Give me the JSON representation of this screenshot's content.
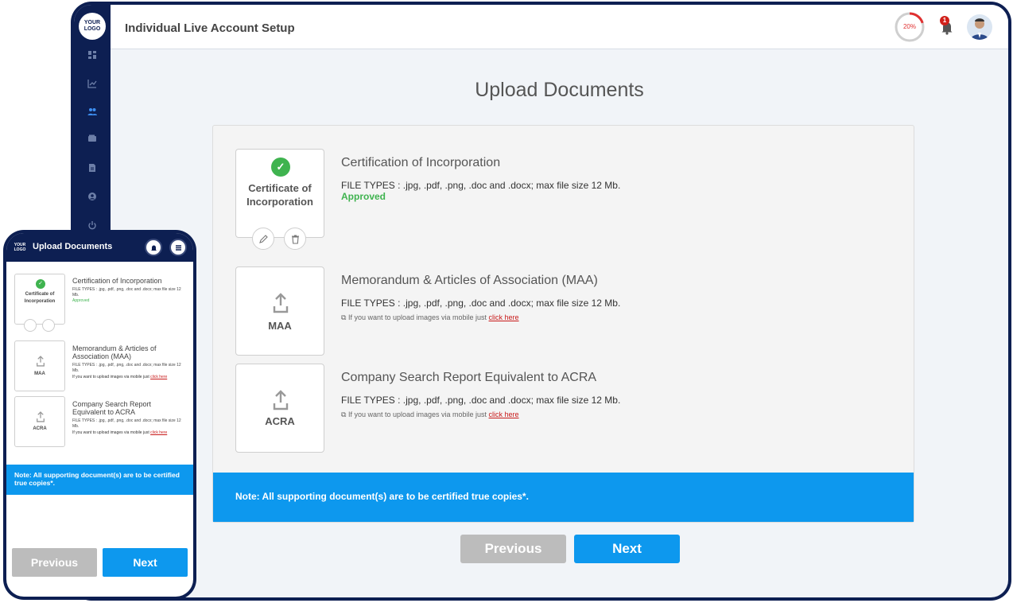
{
  "desktop": {
    "logo_text": "YOUR LOGO",
    "header_title": "Individual Live Account Setup",
    "progress_label": "20%",
    "progress_value": 0.2,
    "notification_count": "1",
    "page_title": "Upload Documents",
    "documents": [
      {
        "card_label": "Certificate of Incorporation",
        "name": "Certification of Incorporation",
        "file_types": "FILE TYPES : .jpg, .pdf, .png, .doc and .docx; max file size 12 Mb.",
        "status": "Approved"
      },
      {
        "card_label": "MAA",
        "name": "Memorandum & Articles of Association (MAA)",
        "file_types": "FILE TYPES : .jpg, .pdf, .png, .doc and .docx; max file size 12 Mb.",
        "mobile_text": "If you want to upload images via mobile just ",
        "mobile_link": "click here"
      },
      {
        "card_label": "ACRA",
        "name": "Company Search Report Equivalent to ACRA",
        "file_types": "FILE TYPES : .jpg, .pdf, .png, .doc and .docx; max file size 12 Mb.",
        "mobile_text": "If you want to upload images via mobile just ",
        "mobile_link": "click here"
      }
    ],
    "note": "Note: All supporting document(s) are to be certified true copies*.",
    "previous_label": "Previous",
    "next_label": "Next"
  },
  "mobile": {
    "logo_text": "YOUR LOGO",
    "title": "Upload Documents",
    "documents": [
      {
        "card_label": "Certificate of Incorporation",
        "name": "Certification of Incorporation",
        "file_types": "FILE TYPES : .jpg, .pdf, .png, .doc and .docx; max file size 12 Mb.",
        "status": "Approved"
      },
      {
        "card_label": "MAA",
        "name": "Memorandum & Articles of Association (MAA)",
        "file_types": "FILE TYPES : .jpg, .pdf, .png, .doc and .docx; max file size 12 Mb.",
        "mobile_text": "If you want to upload images via mobile just ",
        "mobile_link": "click here"
      },
      {
        "card_label": "ACRA",
        "name": "Company Search Report Equivalent to ACRA",
        "file_types": "FILE TYPES : .jpg, .pdf, .png, .doc and .docx; max file size 12 Mb.",
        "mobile_text": "If you want to upload images via mobile just ",
        "mobile_link": "click here"
      }
    ],
    "note": "Note: All supporting document(s) are to be certified true copies*.",
    "previous_label": "Previous",
    "next_label": "Next"
  },
  "colors": {
    "navy": "#0d1f52",
    "accent": "#0d98ee",
    "approved": "#3fb34f",
    "progress": "#e03030"
  },
  "icons": [
    "dashboard-icon",
    "chart-icon",
    "users-icon",
    "wallet-icon",
    "document-icon",
    "account-icon",
    "power-icon",
    "bell-icon",
    "menu-icon",
    "edit-icon",
    "trash-icon",
    "upload-icon",
    "check-icon",
    "mobile-icon"
  ]
}
